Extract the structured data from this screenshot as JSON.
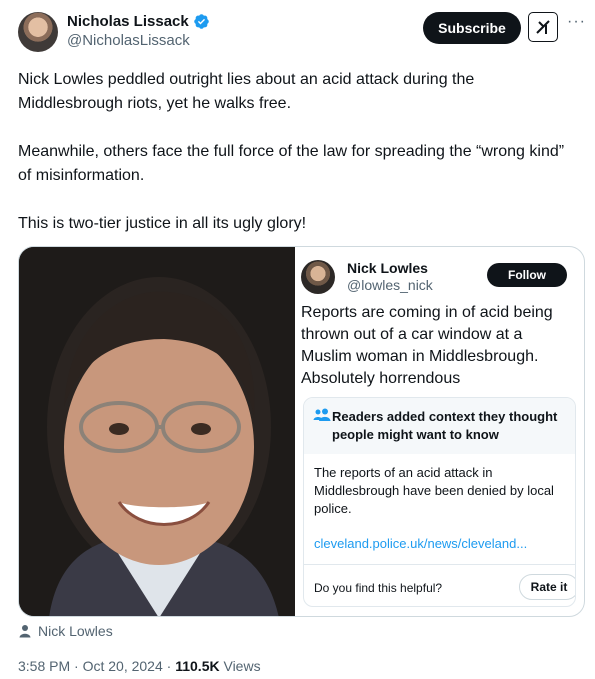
{
  "author": {
    "name": "Nicholas Lissack",
    "handle": "@NicholasLissack",
    "verified": true,
    "avatar_icon": "user-avatar"
  },
  "header_actions": {
    "subscribe_label": "Subscribe",
    "grok_icon": "grok-icon",
    "more_icon": "more-icon"
  },
  "tweet": {
    "paragraphs": [
      "Nick Lowles peddled outright lies about an acid attack during the Middlesbrough riots, yet he walks free.",
      "Meanwhile, others face the full force of the law for spreading the “wrong kind” of misinformation.",
      "This is two-tier justice in all its ugly glory!"
    ]
  },
  "embedded": {
    "name": "Nick Lowles",
    "handle": "@lowles_nick",
    "follow_label": "Follow",
    "text": "Reports are coming in of acid being thrown out of a car window at a Muslim woman in Middlesbrough. Absolutely horrendous",
    "community_note": {
      "title": "Readers added context they thought people might want to know",
      "body": "The reports of an acid attack in Middlesbrough have been denied by local police.",
      "link": "cleveland.police.uk/news/cleveland...",
      "question": "Do you find this helpful?",
      "rate_label": "Rate it"
    }
  },
  "media_tag": {
    "label": "Nick Lowles",
    "icon": "person-icon"
  },
  "meta": {
    "time": "3:58 PM",
    "separator": "·",
    "date": "Oct 20, 2024",
    "views_count": "110.5K",
    "views_label": "Views"
  },
  "colors": {
    "text_primary": "#0f1419",
    "text_secondary": "#536471",
    "link": "#1d9bf0",
    "verified": "#1d9bf0",
    "button_dark": "#0f1419"
  }
}
